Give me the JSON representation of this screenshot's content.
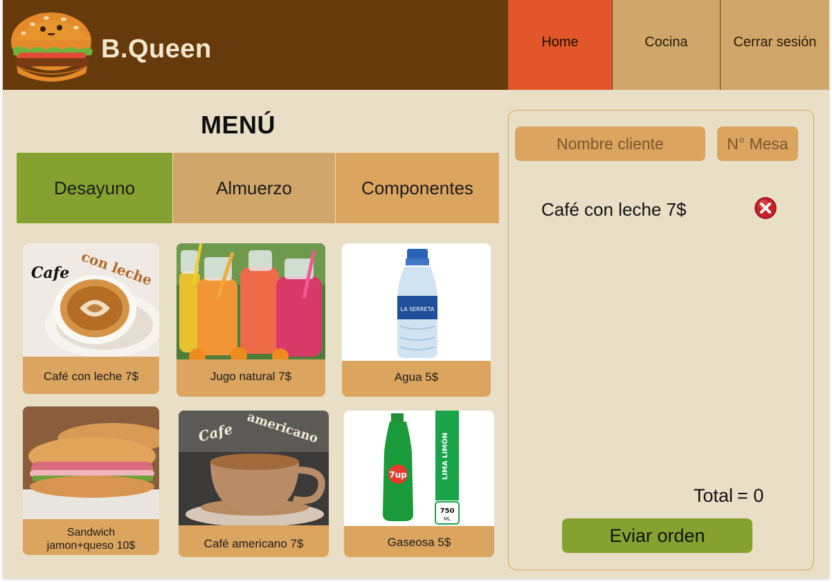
{
  "brand": {
    "name": "B.Queen"
  },
  "nav": {
    "home": "Home",
    "cocina": "Cocina",
    "logout": "Cerrar sesión"
  },
  "menu": {
    "title": "MENÚ",
    "tabs": [
      {
        "label": "Desayuno",
        "active": true
      },
      {
        "label": "Almuerzo",
        "active": false
      },
      {
        "label": "Componentes",
        "active": false
      }
    ],
    "products": [
      {
        "label": "Café con leche 7$",
        "image_text_1": "Cafe",
        "image_text_2": "con leche"
      },
      {
        "label": "Jugo natural 7$"
      },
      {
        "label": "Agua 5$",
        "image_text_1": "LA SERRETA"
      },
      {
        "label_line1": "Sandwich",
        "label_line2": "jamon+queso 10$"
      },
      {
        "label": "Café americano 7$",
        "image_text_1": "Cafe",
        "image_text_2": "americano"
      },
      {
        "label": "Gaseosa 5$",
        "image_text_1": "7up",
        "image_text_2": "LIMA LIMÓN",
        "image_text_3": "750",
        "image_text_4": "ML"
      }
    ]
  },
  "order": {
    "name_placeholder": "Nombre cliente",
    "mesa_placeholder": "N° Mesa",
    "items": [
      {
        "label": "Café con leche 7$"
      }
    ],
    "total_label": "Total",
    "total_equals": "= 0",
    "send_label": "Eviar orden"
  },
  "colors": {
    "header_bg": "#673a0c",
    "home_accent": "#e3562a",
    "tab_active": "#85a130",
    "tan": "#d0a66b",
    "orange_tan": "#dba55f",
    "page_bg": "#e8dfc6"
  }
}
